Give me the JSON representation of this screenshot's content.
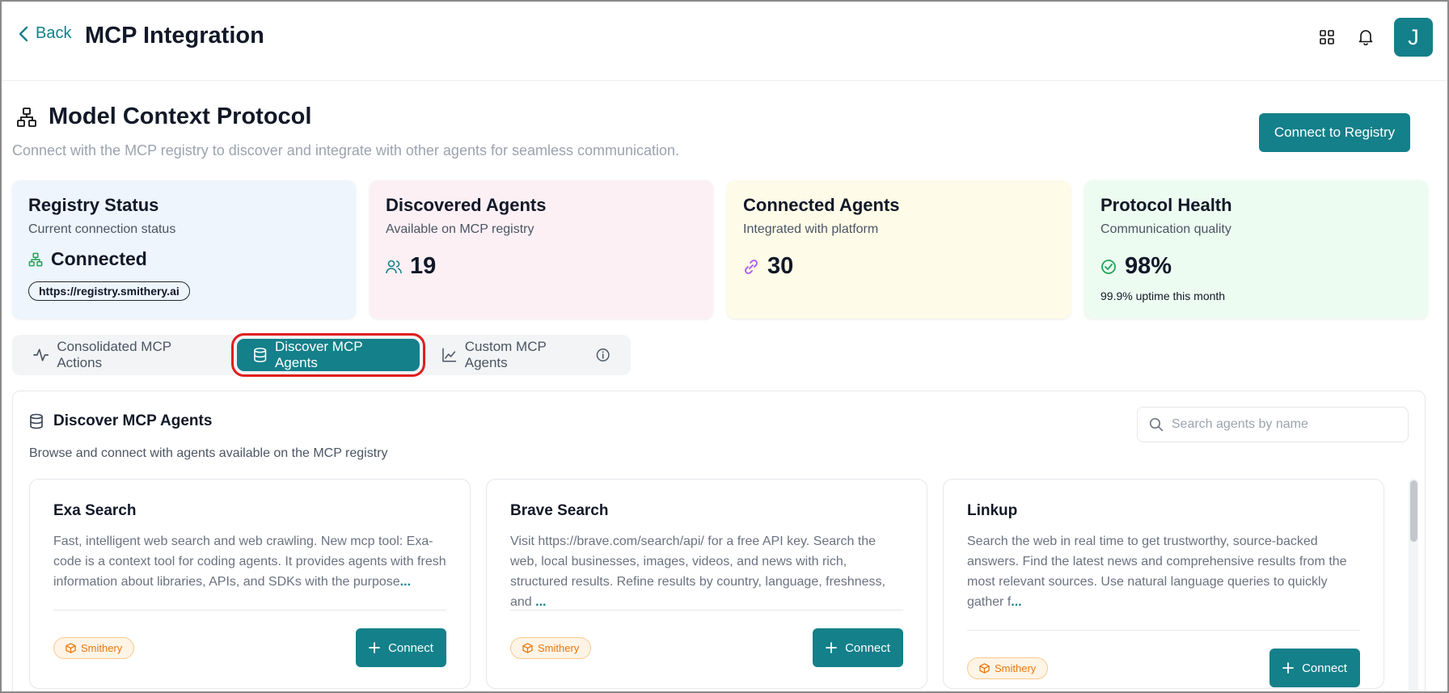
{
  "topbar": {
    "back_label": "Back",
    "title": "MCP Integration",
    "avatar_initial": "J"
  },
  "header": {
    "title": "Model Context Protocol",
    "subtitle": "Connect with the MCP registry to discover and integrate with other agents for seamless communication.",
    "registry_button": "Connect to Registry"
  },
  "stats": {
    "registry": {
      "title": "Registry Status",
      "subtitle": "Current connection status",
      "value": "Connected",
      "url": "https://registry.smithery.ai"
    },
    "discovered": {
      "title": "Discovered Agents",
      "subtitle": "Available on MCP registry",
      "value": "19"
    },
    "connected": {
      "title": "Connected Agents",
      "subtitle": "Integrated with platform",
      "value": "30"
    },
    "health": {
      "title": "Protocol Health",
      "subtitle": "Communication quality",
      "value": "98%",
      "note": "99.9% uptime this month"
    }
  },
  "tabs": [
    {
      "label": "Consolidated MCP Actions",
      "icon": "activity-icon"
    },
    {
      "label": "Discover MCP Agents",
      "icon": "database-icon",
      "active": true
    },
    {
      "label": "Custom MCP Agents",
      "icon": "chart-icon"
    }
  ],
  "panel": {
    "title": "Discover MCP Agents",
    "subtitle": "Browse and connect with agents available on the MCP registry",
    "search_placeholder": "Search agents by name"
  },
  "agents": [
    {
      "name": "Exa Search",
      "description": "Fast, intelligent web search and web crawling. New mcp tool: Exa-code is a context tool for coding agents. It provides agents with fresh information about libraries, APIs, and SDKs with the purpose",
      "more": "...",
      "badge": "Smithery",
      "connect_label": "Connect"
    },
    {
      "name": "Brave Search",
      "description": "Visit https://brave.com/search/api/ for a free API key. Search the web, local businesses, images, videos, and news with rich, structured results. Refine results by country, language, freshness, and ",
      "more": "...",
      "badge": "Smithery",
      "connect_label": "Connect"
    },
    {
      "name": "Linkup",
      "description": "Search the web in real time to get trustworthy, source-backed answers. Find the latest news and comprehensive results from the most relevant sources. Use natural language queries to quickly gather f",
      "more": "...",
      "badge": "Smithery",
      "connect_label": "Connect"
    }
  ],
  "colors": {
    "accent": "#14808a",
    "highlight": "#e11d1d",
    "badge": "#e8770e"
  }
}
